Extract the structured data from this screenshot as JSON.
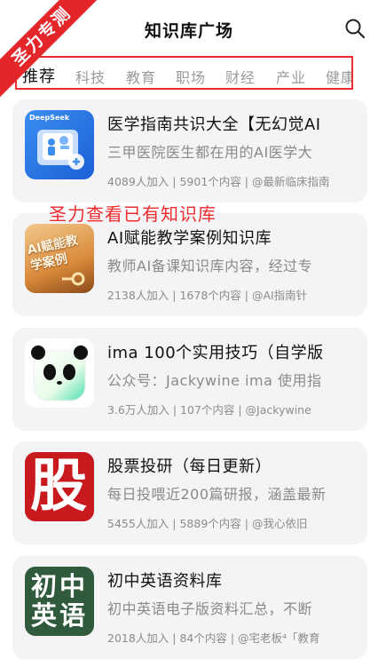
{
  "header": {
    "title": "知识库广场",
    "ribbon": "圣力专测"
  },
  "tabs": [
    "推荐",
    "科技",
    "教育",
    "职场",
    "财经",
    "产业",
    "健康"
  ],
  "overlay_text": "圣力查看已有知识库",
  "cards": [
    {
      "title": "医学指南共识大全【无幻觉AI",
      "desc": "三甲医院医生都在用的AI医学大",
      "meta": "4089人加入 | 5901个内容 | @最新临床指南",
      "thumb_text": "DeepSeek"
    },
    {
      "title": "AI赋能教学案例知识库",
      "desc": "教师AI备课知识库内容，经过专",
      "meta": "2138人加入 | 1678个内容 | @AI指南针",
      "thumb_text": "AI赋能教学案例"
    },
    {
      "title": "ima  100个实用技巧（自学版",
      "desc": "公众号：Jackywine ima 使用指",
      "meta": "3.6万人加入 | 107个内容 | @Jackywine",
      "thumb_text": ""
    },
    {
      "title": "股票投研（每日更新）",
      "desc": "每日投喂近200篇研报，涵盖最新",
      "meta": "5455人加入 | 5889个内容 | @我心依旧",
      "thumb_text": "股"
    },
    {
      "title": "初中英语资料库",
      "desc": "初中英语电子版资料汇总，不断",
      "meta": "2018人加入 | 84个内容 | @宅老板⁴「教育",
      "thumb_text": "初中英语"
    }
  ],
  "colors": {
    "accent_red": "#ee2b2f",
    "card_bg": "#f4f4f6"
  }
}
